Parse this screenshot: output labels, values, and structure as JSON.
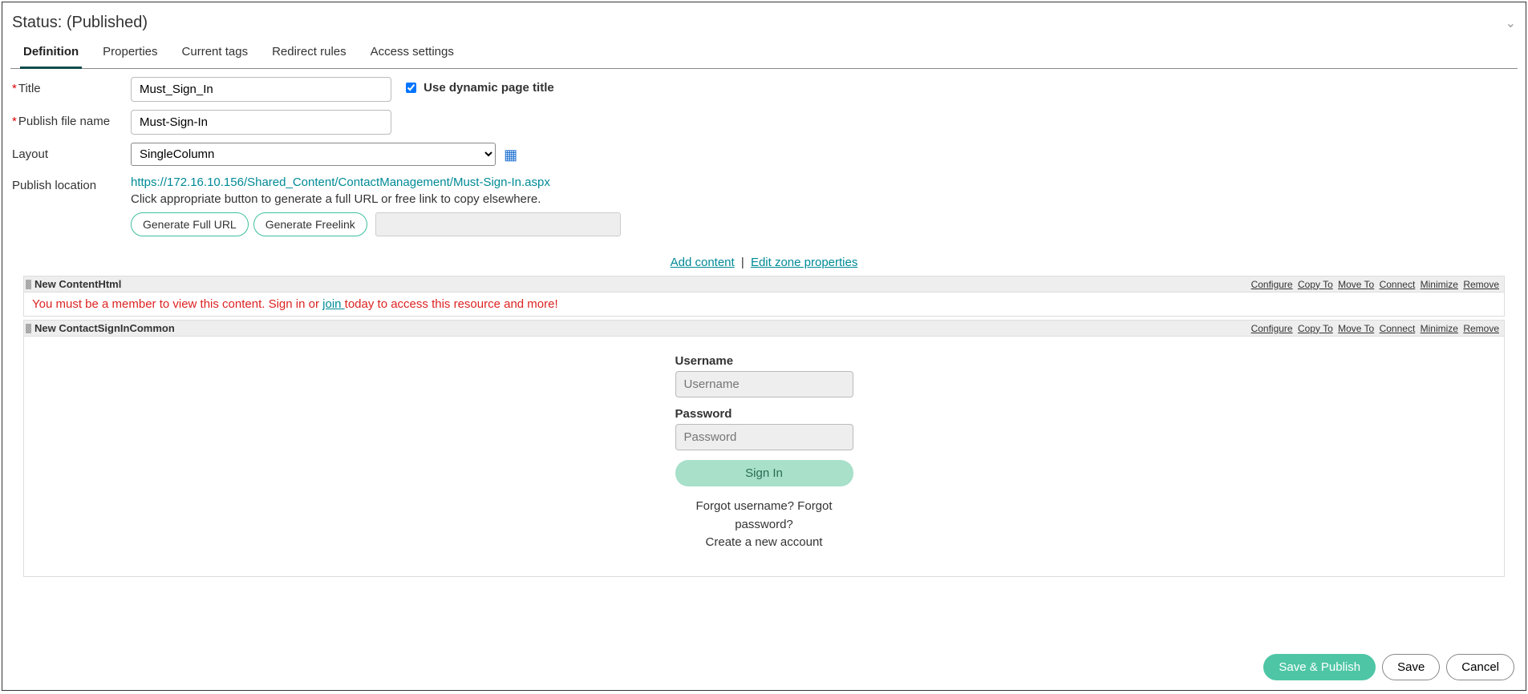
{
  "status_label": "Status: (Published)",
  "tabs": [
    "Definition",
    "Properties",
    "Current tags",
    "Redirect rules",
    "Access settings"
  ],
  "form": {
    "title_label": "Title",
    "title_value": "Must_Sign_In",
    "dynamic_label": "Use dynamic page title",
    "publish_file_label": "Publish file name",
    "publish_file_value": "Must-Sign-In",
    "layout_label": "Layout",
    "layout_value": "SingleColumn",
    "publish_loc_label": "Publish location",
    "publish_url": "https://172.16.10.156/Shared_Content/ContactManagement/Must-Sign-In.aspx",
    "publish_hint": "Click appropriate button to generate a full URL or free link to copy elsewhere.",
    "gen_full_url": "Generate Full URL",
    "gen_freelink": "Generate Freelink"
  },
  "zone": {
    "add_content": "Add content",
    "edit_zone": "Edit zone properties"
  },
  "part_actions": [
    "Configure",
    "Copy To",
    "Move To",
    "Connect",
    "Minimize",
    "Remove"
  ],
  "part1": {
    "title": "New ContentHtml",
    "msg_pre": "You must be a member to view this content. Sign in or ",
    "msg_link": "join ",
    "msg_post": "today to access this resource and more!"
  },
  "part2": {
    "title": "New ContactSignInCommon",
    "username_label": "Username",
    "username_ph": "Username",
    "password_label": "Password",
    "password_ph": "Password",
    "signin_btn": "Sign In",
    "forgot": "Forgot username? Forgot password?",
    "create": "Create a new account"
  },
  "footer": {
    "save_publish": "Save & Publish",
    "save": "Save",
    "cancel": "Cancel"
  }
}
